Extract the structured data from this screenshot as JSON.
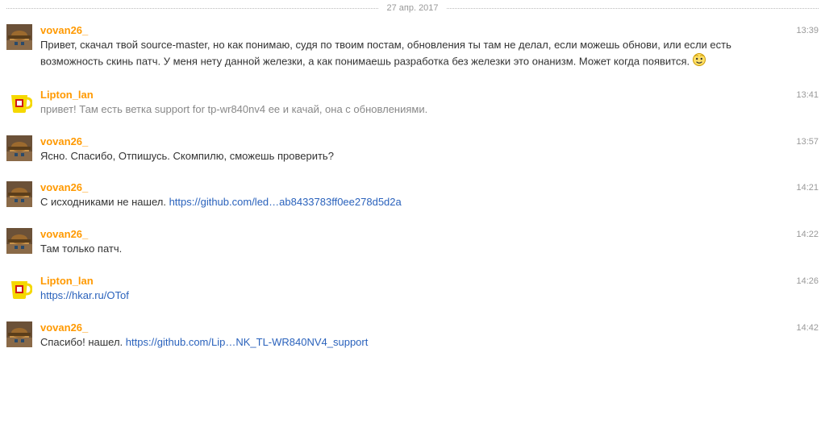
{
  "date": "27 апр. 2017",
  "users": {
    "vovan": {
      "name": "vovan26_",
      "avatar": "hat"
    },
    "lipton": {
      "name": "Lipton_lan",
      "avatar": "cup"
    }
  },
  "messages": [
    {
      "user": "vovan",
      "time": "13:39",
      "parts": [
        {
          "type": "text",
          "value": "Привет, скачал твой source-master, но как понимаю, судя по твоим постам, обновления ты там не делал, если можешь обнови, или если есть возможность скинь патч. У меня нету данной железки, а как понимаешь разработка без железки это онанизм. Может когда появится. "
        },
        {
          "type": "emoji",
          "value": "shy-smile"
        }
      ]
    },
    {
      "user": "lipton",
      "time": "13:41",
      "muted": true,
      "parts": [
        {
          "type": "text",
          "value": "привет! Там есть ветка support for tp-wr840nv4 ее и качай, она с обновлениями."
        }
      ]
    },
    {
      "user": "vovan",
      "time": "13:57",
      "parts": [
        {
          "type": "text",
          "value": "Ясно. Спасибо, Отпишусь. Скомпилю, сможешь проверить?"
        }
      ]
    },
    {
      "user": "vovan",
      "time": "14:21",
      "parts": [
        {
          "type": "text",
          "value": "С исходниками не нашел. "
        },
        {
          "type": "link",
          "value": "https://github.com/led…ab8433783ff0ee278d5d2a"
        }
      ]
    },
    {
      "user": "vovan",
      "time": "14:22",
      "parts": [
        {
          "type": "text",
          "value": "Там только патч."
        }
      ]
    },
    {
      "user": "lipton",
      "time": "14:26",
      "parts": [
        {
          "type": "link",
          "value": "https://hkar.ru/OTof"
        }
      ]
    },
    {
      "user": "vovan",
      "time": "14:42",
      "parts": [
        {
          "type": "text",
          "value": "Спасибо! нашел. "
        },
        {
          "type": "link",
          "value": "https://github.com/Lip…NK_TL-WR840NV4_support"
        }
      ]
    }
  ]
}
